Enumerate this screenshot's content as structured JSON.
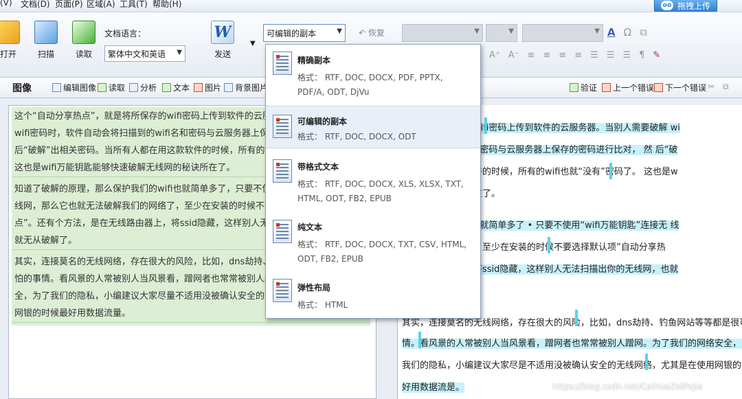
{
  "menu": [
    "(V)",
    "文档(D)",
    "页面(P)",
    "区域(A)",
    "工具(T)",
    "帮助(H)"
  ],
  "upload_button": "拖拽上传",
  "toolbar": {
    "open": "打开",
    "scan": "扫描",
    "read": "读取",
    "doc_lang_label": "文档语言：",
    "doc_lang_value": "繁体中文和英语",
    "send": "发送",
    "copy_select": "可编辑的副本",
    "restore": "恢复"
  },
  "subbar": {
    "title": "图像",
    "edit_image": "编辑图像",
    "read": "读取",
    "analyze": "分析",
    "text": "文本",
    "picture": "图片",
    "background_picture": "背景图片",
    "verify": "验证",
    "prev_error": "上一个错误",
    "next_error": "下一个错误"
  },
  "dropdown": [
    {
      "name": "精确副本",
      "formats": "格式：  RTF, DOC, DOCX, PDF, PPTX, PDF/A, ODT, DjVu"
    },
    {
      "name": "可编辑的副本",
      "formats": "格式：  RTF, DOC, DOCX, ODT"
    },
    {
      "name": "带格式文本",
      "formats": "格式：  RTF, DOC, DOCX, XLS, XLSX, TXT, HTML, ODT, FB2, EPUB"
    },
    {
      "name": "纯文本",
      "formats": "格式：  RTF, DOC, DOCX, TXT, CSV, HTML, ODT, FB2, EPUB"
    },
    {
      "name": "弹性布局",
      "formats": "格式：  HTML"
    }
  ],
  "left_text": [
    "这个“自动分享热点”，就是将所保存的wifi密码上传到软件的云服务器。当别人需要破解wifi密码时，软件自动会将扫描到的wifi名和密码与云服务器上保存的密码进行比对，然后“破解”出相关密码。当所有人都在用这款软件的时候，所有的wifi也就“没有”密码了。这也是wifi万能钥匙能够快速破解无线网的秘诀所在了。",
    "知道了破解的原理，那么保护我们的wifi也就简单多了，只要不使用“wifi万能钥匙”连接无线网，那么它也就无法破解我们的网络了，至少在安装的时候不要选择默认项“自动分享热点”。还有个方法，是在无线路由器上，将ssid隐藏，这样别人无法扫描出你的无线网，也就无从破解了。",
    "其实，连接莫名的无线网络，存在很大的风险，比如，dns劫持、钓鱼网站等等都是很可怕的事情。看风景的人常被别人当风景看，蹭网者也常常被别人蹭网。为了我们的网络安全，为了我们的隐私，小编建议大家尽量不适用没被确认安全的无线网络，尤其是在使用网银的时候最好用数据流量。"
  ],
  "right_lines": [
    "，就是将所保存的wifi密码上传到软件的云服务器。当别人需要破解 wi",
    "持扫描到的wifi名和密码与云服务器上保存的密码进行比对， 然 后“破",
    "有人都在用这款软件的时候，所有的wifi也就“没有”密码了。 这也是w",
    "解无线网的秘诀所在了。",
    "么保护我们的wifi也就简单多了 • 只要不使用“wifi万能钥匙”连接无 线",
    "破解我们的网络了，至少在安装的时候不要选择默认项”自动分享热",
    "在无线路由器上，将ssid隐藏，这样别人无法扫描出你的无线网，也就",
    "其实，连接莫名的无线网络，存在很大的风险，比如，dns劫持、钓鱼网站等等都是很可怕的",
    "情。看风景的人常被别人当风景看，蹭网者也常常被别人蹭网。为了我们的网络安全，为",
    "我们的隐私，小编建议大家尽是不适用没被确认安全的无线网络，尤其是在使用网银的时候",
    "好用数据流是。"
  ],
  "watermark": "https://blog.csdn.net/CaiHuaZeiPoJie"
}
